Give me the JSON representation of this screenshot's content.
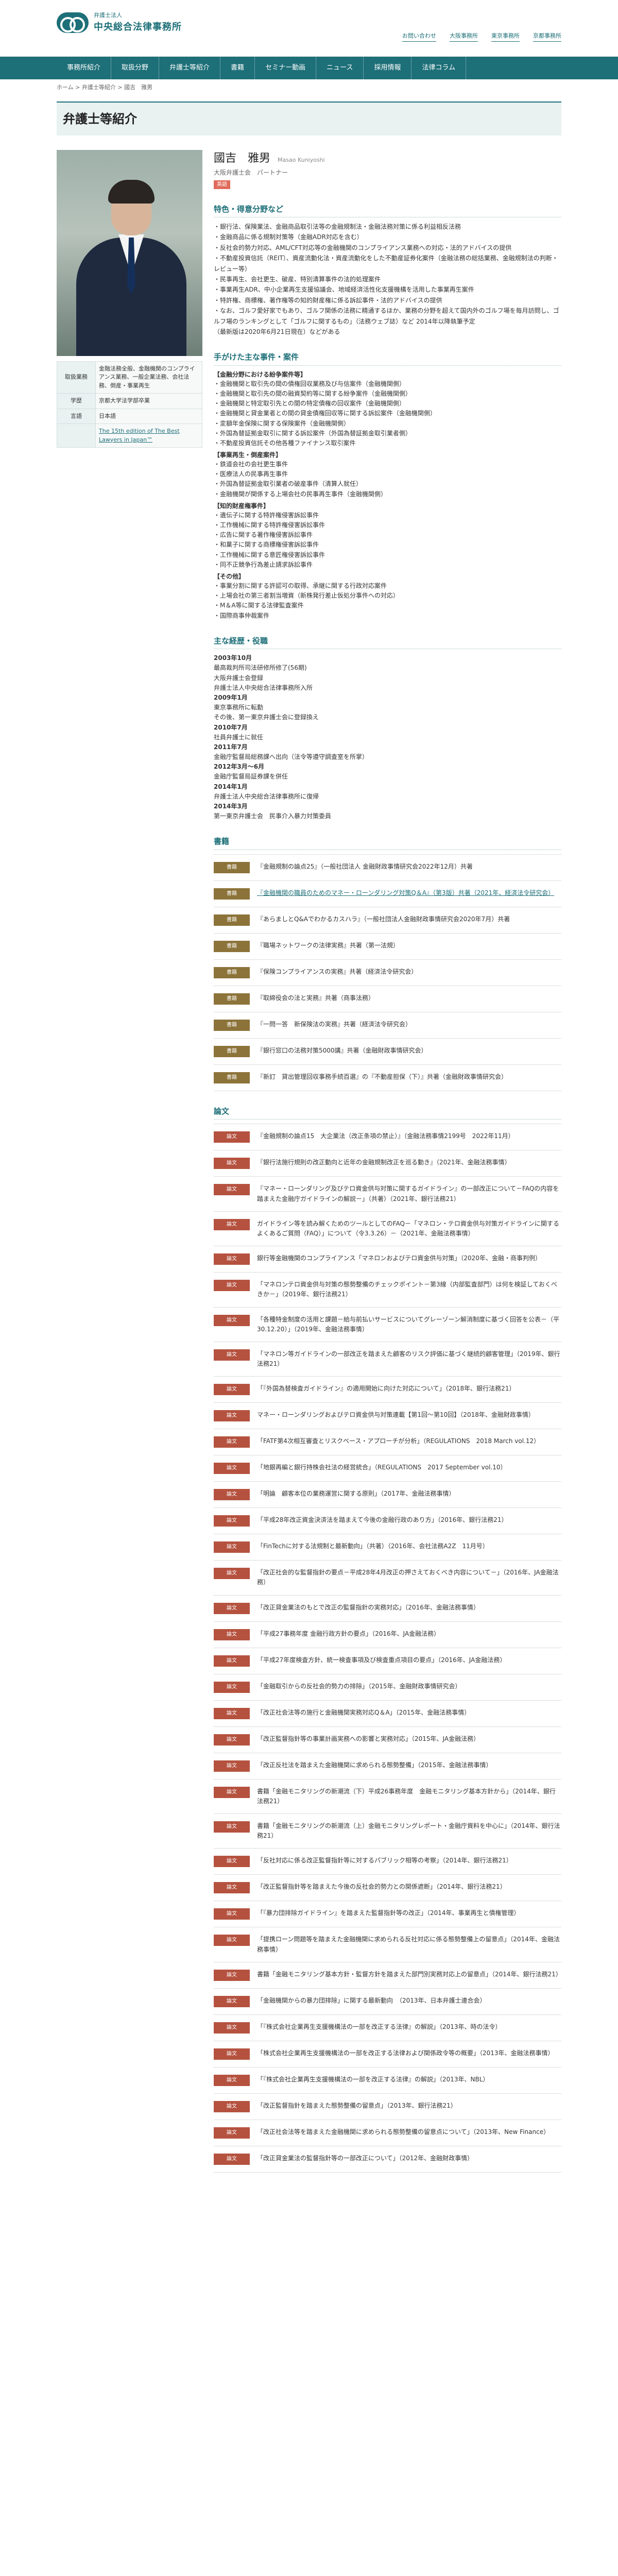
{
  "header": {
    "logo_sub": "弁護士法人",
    "logo_main": "中央総合法律事務所",
    "top_links": [
      "お問い合わせ",
      "大阪事務所",
      "東京事務所",
      "京都事務所"
    ]
  },
  "nav": [
    "事務所紹介",
    "取扱分野",
    "弁護士等紹介",
    "書籍",
    "セミナー動画",
    "ニュース",
    "採用情報",
    "法律コラム"
  ],
  "breadcrumb": "ホーム > 弁護士等紹介 > 國吉　雅男",
  "page_title": "弁護士等紹介",
  "profile": {
    "name": "國吉　雅男",
    "name_roman": "Masao Kuniyoshi",
    "role": "大阪弁護士会　パートナー",
    "lang_badge": "英語",
    "info": [
      {
        "label": "取扱業務",
        "value": "金融法務全般、金融機関のコンプライアンス業務、一般企業法務、会社法務、倒産・事業再生"
      },
      {
        "label": "学歴",
        "value": "京都大学法学部卒業"
      },
      {
        "label": "言語",
        "value": "日本語"
      },
      {
        "label": "",
        "value": "The 15th edition of The Best Lawyers in Japan™"
      }
    ]
  },
  "specialty": {
    "heading": "特色・得意分野など",
    "lines": [
      "・銀行法、保険業法、金融商品取引法等の金融規制法・金融法務対策に係る利益相反法務",
      "・金融商品に係る規制対策等（金融ADR対応を含む）",
      "・反社会的勢力対応、AML/CFT対応等の金融機関のコンプライアンス業務への対応・法的アドバイスの提供",
      "・不動産投資信託（REIT）、資産流動化法・資産流動化をした不動産証券化案件（金融法務の総括業務、金融規制法の判断・レビュー等）",
      "・民事再生、会社更生、破産、特別清算事件の法的処理案件",
      "・事業再生ADR、中小企業再生支援協議会、地域経済活性化支援機構を活用した事業再生案件",
      "・特許権、商標権、著作権等の知的財産権に係る訴訟事件・法的アドバイスの提供",
      "・なお、ゴルフ愛好家でもあり、ゴルフ関係の法務に精通するほか、業務の分野を超えて国内外のゴルフ場を毎月訪問し、ゴルフ場のランキングとして「ゴルフに関するもの」（法務ウェブ誌）など 2014年以降執筆予定",
      "（最新版は2020年6月21日現在）などがある"
    ]
  },
  "cases": {
    "heading": "手がけた主な事件・案件",
    "groups": [
      {
        "title": "【金融分野における紛争案件等】",
        "items": [
          "・金融機関と取引先の間の債権回収業務及び与信案件（金融機関側）",
          "・金融機関と取引先の間の融資契約等に関する紛争案件（金融機関側）",
          "・金融機関と特定取引先との間の特定債権の回収案件（金融機関側）",
          "・金融機関と貸金業者との間の貸金債権回収等に関する訴訟案件（金融機関側）",
          "・変額年金保険に関する保険案件（金融機関側）",
          "・外国為替証拠金取引に関する訴訟案件（外国為替証拠金取引業者側）",
          "・不動産投資信託その他各種ファイナンス取引案件"
        ]
      },
      {
        "title": "【事業再生・倒産案件】",
        "items": [
          "・鉄道会社の会社更生事件",
          "・医療法人の民事再生事件",
          "・外国為替証拠金取引業者の破産事件（清算人就任）",
          "・金融機関が関係する上場会社の民事再生事件（金融機関側）"
        ]
      },
      {
        "title": "【知的財産権事件】",
        "items": [
          "・遺伝子に関する特許権侵害訴訟事件",
          "・工作機械に関する特許権侵害訴訟事件",
          "・広告に関する著作権侵害訴訟事件",
          "・和菓子に関する商標権侵害訴訟事件",
          "・工作機械に関する意匠権侵害訴訟事件",
          "・同不正競争行為差止請求訴訟事件"
        ]
      },
      {
        "title": "【その他】",
        "items": [
          "・事業分割に関する許認可の取得、承継に関する行政対応案件",
          "・上場会社の第三者割当増資（新株発行差止仮処分事件への対応）",
          "・M＆A等に関する法律監査案件",
          "・国際商事仲裁案件"
        ]
      }
    ]
  },
  "career": {
    "heading": "主な経歴・役職",
    "items": [
      {
        "y": "2003年10月",
        "t": "最高裁判所司法研修所修了(56期)"
      },
      {
        "y": "",
        "t": "大阪弁護士会登録"
      },
      {
        "y": "",
        "t": "弁護士法人中央総合法律事務所入所"
      },
      {
        "y": "2009年1月",
        "t": "東京事務所に転勤"
      },
      {
        "y": "",
        "t": "その後、第一東京弁護士会に登録換え"
      },
      {
        "y": "2010年7月",
        "t": "社員弁護士に就任"
      },
      {
        "y": "2011年7月",
        "t": "金融庁監督局総務課へ出向（法令等遵守調査室を所掌）"
      },
      {
        "y": "2012年3月〜6月",
        "t": "金融庁監督局証券課を併任"
      },
      {
        "y": "2014年1月",
        "t": "弁護士法人中央総合法律事務所に復帰"
      },
      {
        "y": "2014年3月",
        "t": "第一東京弁護士会　民事介入暴力対策委員"
      }
    ]
  },
  "books": {
    "heading": "書籍",
    "tag": "書籍",
    "items": [
      {
        "t": "『金融規制の論点25』（一般社団法人 金融財政事情研究会2022年12月）共著",
        "link": false
      },
      {
        "t": "『金融機関の職員のためのマネー・ローンダリング対策Q＆A』（第3版）共著（2021年、経済法令研究会）",
        "link": true
      },
      {
        "t": "『あらましとQ&Aでわかるカスハラ』（一般社団法人金融財政事情研究会2020年7月）共著",
        "link": false
      },
      {
        "t": "『職場ネットワークの法律実務』共著（第一法規）",
        "link": false
      },
      {
        "t": "『保険コンプライアンスの実務』共著（経済法令研究会）",
        "link": false
      },
      {
        "t": "『取締役会の法と実務』共著（商事法務）",
        "link": false
      },
      {
        "t": "『一問一答　新保険法の実務』共著（経済法令研究会）",
        "link": false
      },
      {
        "t": "『銀行窓口の法務対策5000講』共著（金融財政事情研究会）",
        "link": false
      },
      {
        "t": "『新訂　貸出管理回収事務手続百選』の『不動産担保（下）』共著（金融財政事情研究会）",
        "link": false
      }
    ]
  },
  "articles": {
    "heading": "論文",
    "tag": "論文",
    "items": [
      "『金融規制の論点15　大企業法（改正条項の禁止）』（金融法務事情2199号　2022年11月）",
      "『銀行法施行規則の改正動向と近年の金融規制改正を巡る動き』（2021年、金融法務事情）",
      "『マネー・ローンダリング及びテロ資金供与対策に関するガイドライン』の一部改正について－FAQの内容を踏まえた金融庁ガイドラインの解説－」（共著）（2021年、銀行法務21）",
      "ガイドライン等を読み解くためのツールとしてのFAQ－「マネロン・テロ資金供与対策ガイドラインに関するよくあるご質問（FAQ）」について（令3.3.26）－（2021年、金融法務事情）",
      "銀行等金融機関のコンプライアンス「マネロンおよびテロ資金供与対策」（2020年、金融・商事判例）",
      "「マネロンテロ資金供与対策の態勢整備のチェックポイント－第3線（内部監査部門）は何を検証しておくべきか－」（2019年、銀行法務21）",
      "「各種特金制度の活用と課題－給与前払いサービスについてグレーゾーン解消制度に基づく回答を公表－（平30.12.20）」（2019年、金融法務事情）",
      "「マネロン等ガイドラインの一部改正を踏まえた顧客のリスク評価に基づく継続的顧客管理」（2019年、銀行法務21）",
      "「『外国為替検査ガイドライン』の適用開始に向けた対応について」（2018年、銀行法務21）",
      "マネー・ローンダリングおよびテロ資金供与対策連載【第1回〜第10回】（2018年、金融財政事情）",
      "「FATF第4次相互審査とリスクベース・アプローチが分析」（REGULATIONS　2018 March vol.12）",
      "「地銀再編と銀行持株会社法の経営統合」（REGULATIONS　2017 September vol.10）",
      "「明論　顧客本位の業務運営に関する原則」（2017年、金融法務事情）",
      "「平成28年改正資金決済法を踏まえて今後の金融行政のあり方」（2016年、銀行法務21）",
      "「FinTechに対する法規制と最新動向」（共著）（2016年、会社法務A2Z　11月号）",
      "「改正社会的な監督指針の要点－平成28年4月改正の押さえておくべき内容について－」（2016年、JA金融法務）",
      "「改正貸金業法のもとで改正の監督指針の実務対応」（2016年、金融法務事情）",
      "「平成27事務年度 金融行政方針の要点」（2016年、JA金融法務）",
      "「平成27年度検査方針、統一検査事項及び検査重点項目の要点」（2016年、JA金融法務）",
      "「金融取引からの反社会的勢力の排除」（2015年、金融財政事情研究会）",
      "「改正社会法等の施行と金融機関実務対応Q＆A」（2015年、金融法務事情）",
      "「改正監督指針等の事業計画実務への影響と実務対応」（2015年、JA金融法務）",
      "「改正反社法を踏まえた金融機関に求められる態勢整備」（2015年、金融法務事情）",
      "書籍「金融モニタリングの新潮流（下）平成26事務年度　金融モニタリング基本方針から」（2014年、銀行法務21）",
      "書籍「金融モニタリングの新潮流（上）金融モニタリングレポート・金融庁資料を中心に」（2014年、銀行法務21）",
      "「反社対応に係る改正監督指針等に対するパブリック相等の考察」（2014年、銀行法務21）",
      "「改正監督指針等を踏まえた今後の反社会的勢力との関係遮断」（2014年、銀行法務21）",
      "「『暴力団排除ガイドライン』を踏まえた監督指針等の改正」（2014年、事業再生と債権管理）",
      "「提携ローン問題等を踏まえた金融機関に求められる反社対応に係る態勢整備上の留意点」（2014年、金融法務事情）",
      "書籍「金融モニタリング基本方針・監督方針を踏まえた部門別実務対応上の留意点」（2014年、銀行法務21）",
      "「金融機関からの暴力団排除」に関する最新動向　（2013年、日本弁護士連合会）",
      "「『株式会社企業再生支援機構法の一部を改正する法律』の解説」（2013年、時の法令）",
      "「株式会社企業再生支援機構法の一部を改正する法律および関係政令等の概要」（2013年、金融法務事情）",
      "「『株式会社企業再生支援機構法の一部を改正する法律』の解説」（2013年、NBL）",
      "「改正監督指針を踏まえた態勢整備の留意点」（2013年、銀行法務21）",
      "「改正社会法等を踏まえた金融機関に求められる態勢整備の留意点について」（2013年、New Finance）",
      "「改正貸金業法の監督指針等の一部改正について」（2012年、金融財政事情）"
    ]
  }
}
